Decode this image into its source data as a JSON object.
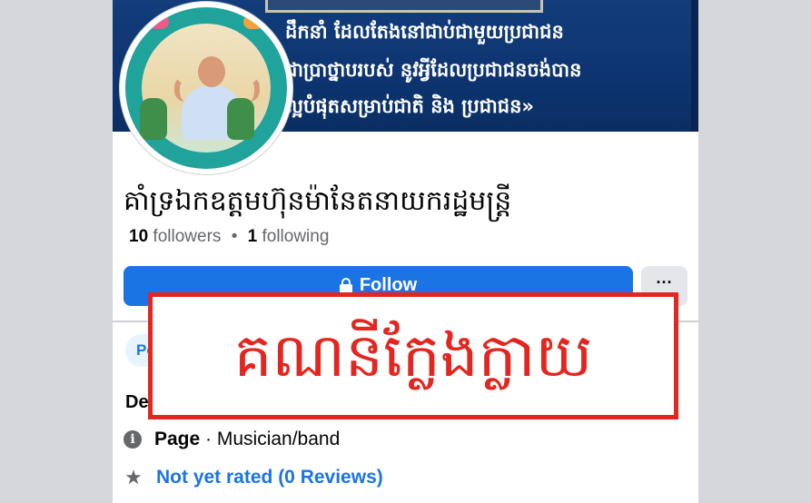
{
  "cover": {
    "lines": [
      "ដឹកនាំ ដែលតែងនៅជាប់ជាមួយប្រជាជន",
      "ជាប្រាថ្នាបរបស់ នូវអ្វីដែលប្រជាជនចង់បាន",
      "ល្អបំផុតសម្រាប់ជាតិ និង ប្រជាជន»"
    ]
  },
  "profile": {
    "name": "គាំទ្រឯកឧត្តមហ៊ុនម៉ានែតនាយករដ្ឋមន្ត្រី",
    "followers_count": "10",
    "followers_label": "followers",
    "separator": "•",
    "following_count": "1",
    "following_label": "following"
  },
  "actions": {
    "follow_label": "Follow",
    "more_label": "···"
  },
  "tabs": {
    "posts_label": "Posts"
  },
  "details": {
    "heading": "Details",
    "page_type_label": "Page",
    "page_category": " · Musician/band",
    "rating": "Not yet rated (0 Reviews)"
  },
  "stamp": {
    "text": "គណនីក្លែងក្លាយ",
    "color": "#e3261f"
  },
  "colors": {
    "accent": "#1b74e4",
    "cover": "#123d7a"
  }
}
